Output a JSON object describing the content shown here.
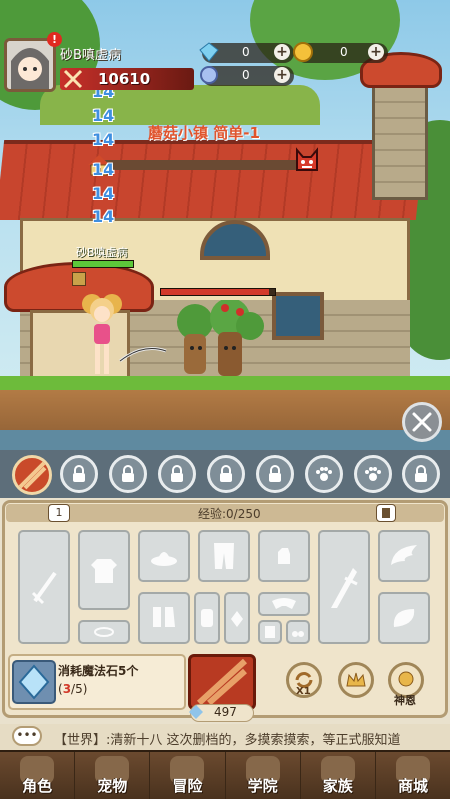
{
  "player": {
    "name": "砂B嗔虚病",
    "power": "10610",
    "alert_badge": "!"
  },
  "resources": [
    {
      "icon": "diamond-icon",
      "value": "0",
      "plus": "+"
    },
    {
      "icon": "coin-icon",
      "value": "0",
      "plus": "+"
    },
    {
      "icon": "gem-icon",
      "value": "0",
      "plus": "+"
    }
  ],
  "battle": {
    "stage_title": "蘑菇小镇 简单-1",
    "hero_label": "砂B嗔虚病",
    "damage_numbers": [
      "14",
      "14",
      "14",
      "14",
      "14",
      "14"
    ],
    "hero_hp_fraction": 1.0,
    "enemy_hp_fraction": 0.95
  },
  "panel": {
    "level_badge": "1",
    "exp_label": "经验:0/250",
    "consume_label": "消耗魔法石5个",
    "consume_progress": "3",
    "consume_total": "/5)",
    "consume_open": "(",
    "stone_count": "497",
    "multiplier_label": "X1",
    "blessing_label": "神恩"
  },
  "chat": {
    "text": "【世界】:清新十八  这次删档的，多摸索摸索，等正式服知道"
  },
  "nav": [
    {
      "label": "角色",
      "icon": "character-icon"
    },
    {
      "label": "宠物",
      "icon": "pet-icon"
    },
    {
      "label": "冒险",
      "icon": "adventure-icon"
    },
    {
      "label": "学院",
      "icon": "academy-icon"
    },
    {
      "label": "家族",
      "icon": "family-icon"
    },
    {
      "label": "商城",
      "icon": "shop-icon"
    }
  ],
  "colors": {
    "accent": "#cc4a2e",
    "exp_text": "#4c3d2b",
    "progress_red": "#d23a2a",
    "damage_blue": "#3f8fe0"
  }
}
